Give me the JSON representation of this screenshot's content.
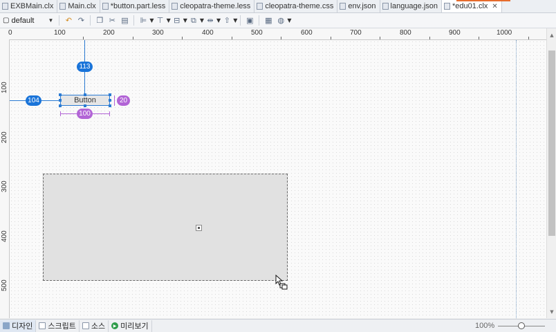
{
  "tabs": [
    {
      "label": "EXBMain.clx",
      "active": false
    },
    {
      "label": "Main.clx",
      "active": false
    },
    {
      "label": "*button.part.less",
      "active": false
    },
    {
      "label": "cleopatra-theme.less",
      "active": false
    },
    {
      "label": "cleopatra-theme.css",
      "active": false
    },
    {
      "label": "env.json",
      "active": false
    },
    {
      "label": "language.json",
      "active": false
    },
    {
      "label": "*edu01.clx",
      "active": true
    }
  ],
  "toolbar": {
    "profile_value": "default"
  },
  "ruler": {
    "top_labels": [
      "0",
      "100",
      "200",
      "300",
      "400",
      "500",
      "600",
      "700",
      "800",
      "900",
      "1000"
    ],
    "left_labels": [
      "100",
      "200",
      "300",
      "400",
      "500"
    ]
  },
  "canvas": {
    "button_label": "Button",
    "dim_top": "113",
    "dim_left": "104",
    "dim_width": "100",
    "dim_height": "20"
  },
  "bottom": {
    "tabs": [
      {
        "label": "디자인",
        "icon": "design-icon"
      },
      {
        "label": "스크립트",
        "icon": "script-icon"
      },
      {
        "label": "소스",
        "icon": "source-icon"
      },
      {
        "label": "미리보기",
        "icon": "preview-play-icon"
      }
    ],
    "zoom_label": "100%",
    "zoom_level": 0.5
  },
  "colors": {
    "selection_blue": "#1a74d9",
    "dimension_purple": "#b264d6",
    "active_tab_accent": "#e66c2c"
  }
}
